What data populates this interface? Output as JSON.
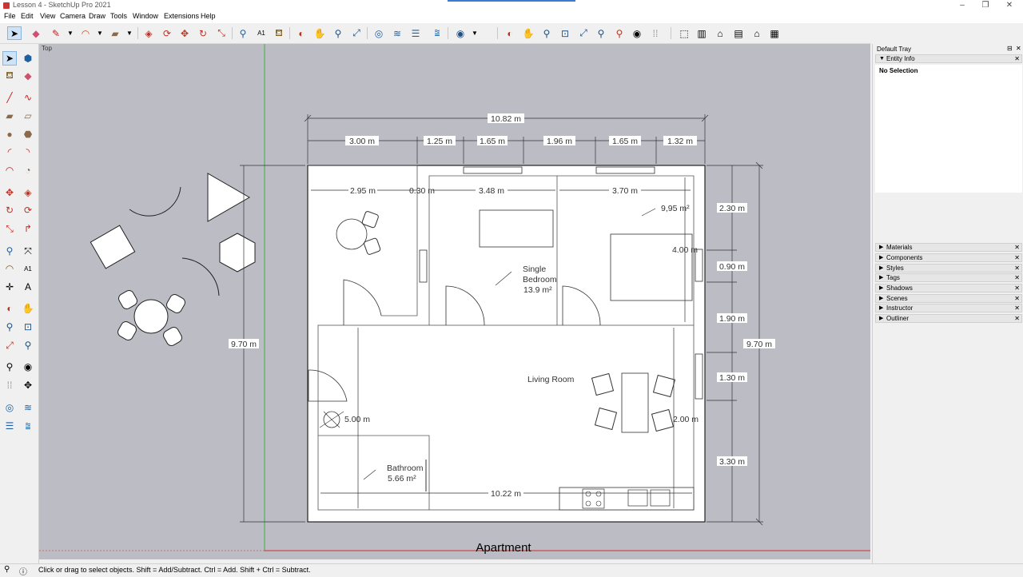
{
  "window": {
    "title": "Lesson 4 - SketchUp Pro 2021",
    "controls": [
      "–",
      "❐",
      "✕"
    ]
  },
  "menu": [
    "File",
    "Edit",
    "View",
    "Camera",
    "Draw",
    "Tools",
    "Window",
    "Extensions",
    "Help"
  ],
  "viewport": {
    "view_label": "Top",
    "drawing_label": "Apartment",
    "top_dimensions": [
      "10.82 m",
      "3.00 m",
      "1.25 m",
      "1.65 m",
      "1.96 m",
      "1.65 m",
      "1.32 m"
    ],
    "inner_dimensions": [
      "2.95 m",
      "0.30 m",
      "3.48 m",
      "3.70 m",
      "4.00 m",
      "5.00 m",
      "2.00 m",
      "10.22 m"
    ],
    "right_dimensions": [
      "2.30 m",
      "0.90 m",
      "1.90 m",
      "1.30 m",
      "3.30 m"
    ],
    "overall_height_left": "9.70 m",
    "overall_height_right": "9.70 m",
    "rooms": {
      "single_bedroom_name": "Single",
      "single_bedroom_name2": "Bedroom",
      "single_bedroom_area": "13.9 m²",
      "main_bedroom_area": "9,95 m²",
      "living_room": "Living Room",
      "bathroom_name": "Bathroom",
      "bathroom_area": "5.66 m²"
    }
  },
  "tray": {
    "title": "Default Tray",
    "entity_info": {
      "label": "Entity Info",
      "body": "No Selection"
    },
    "panels": [
      "Materials",
      "Components",
      "Styles",
      "Tags",
      "Shadows",
      "Scenes",
      "Instructor",
      "Outliner"
    ]
  },
  "status": {
    "message": "Click or drag to select objects. Shift = Add/Subtract. Ctrl = Add. Shift + Ctrl = Subtract."
  },
  "colors": {
    "viewport_bg": "#bcbcc5",
    "green_axis": "#3cb043",
    "red_axis": "#d03030",
    "selected_tool": "#cfe3f7"
  },
  "icons": {
    "toolbar": [
      "select-arrow-icon",
      "eraser-icon",
      "pencil-line-icon",
      "line-dropdown-icon",
      "arc-icon",
      "arc-dropdown-icon",
      "rectangle-icon",
      "rectangle-dropdown-icon",
      "push-pull-icon",
      "follow-me-icon",
      "move-icon",
      "rotate-icon",
      "scale-icon",
      "tape-measure-icon",
      "text-icon",
      "paint-bucket-icon",
      "orbit-icon",
      "pan-icon",
      "zoom-icon",
      "zoom-extents-icon",
      "sandbox-from-contours-icon",
      "sandbox-smoove-icon",
      "sandbox-stamp-icon",
      "sandbox-drape-icon",
      "user-account-icon",
      "user-dropdown-icon",
      "orbit-icon-2",
      "pan-icon-2",
      "zoom-icon-2",
      "zoom-window-icon",
      "zoom-extents-icon-2",
      "position-camera-icon",
      "look-around-icon",
      "walk-icon",
      "iso-view-icon",
      "front-view-icon",
      "house-icon",
      "right-view-icon",
      "back-view-icon",
      "top-view-icon"
    ]
  }
}
